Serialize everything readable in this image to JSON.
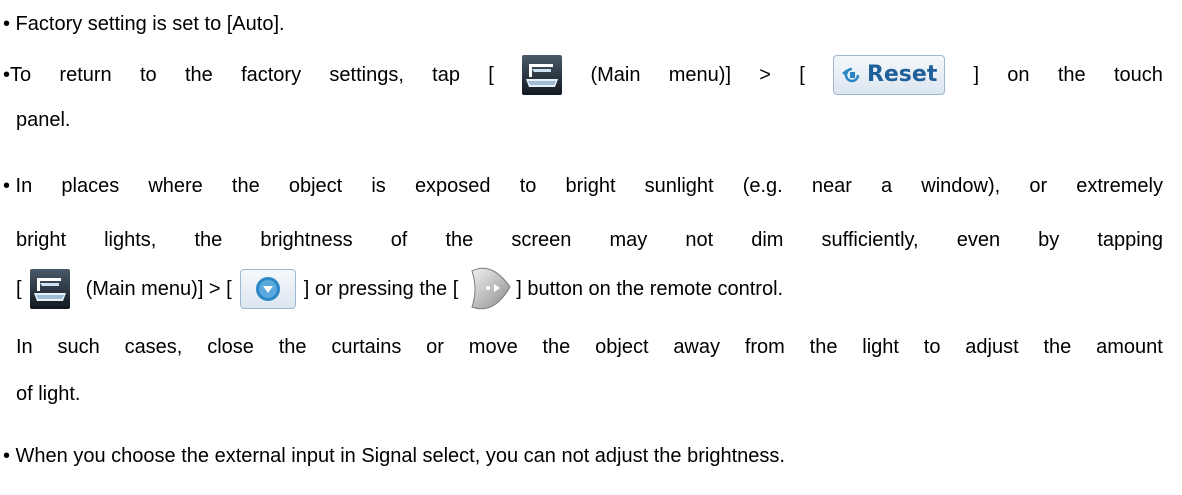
{
  "bullets": {
    "b1": "• Factory setting is set to [Auto].",
    "b2": {
      "w1": "•To",
      "w2": "return",
      "w3": "to",
      "w4": "the",
      "w5": "factory",
      "w6": "settings,",
      "w7": "tap",
      "w8": "[",
      "after_menu": "(Main",
      "w9": "menu)]",
      "w10": ">",
      "w11": "[",
      "reset_label": "Reset",
      "w12": "]",
      "w13": "on",
      "w14": "the",
      "w15": "touch",
      "line2": "panel."
    },
    "b3": {
      "line1": [
        "• In",
        "places",
        "where",
        "the",
        "object",
        "is",
        "exposed",
        "to",
        "bright",
        "sunlight",
        "(e.g.",
        "near",
        "a",
        "window),",
        "or",
        "extremely"
      ],
      "line2": [
        "bright",
        "lights,",
        "the",
        "brightness",
        "of",
        "the",
        "screen",
        "may",
        "not",
        "dim",
        "sufficiently,",
        "even",
        "by",
        "tapping"
      ],
      "l3_open": "[",
      "l3_menu": "(Main menu)] > [",
      "l3_mid": "] or pressing the [",
      "l3_end": "] button on the remote control.",
      "line4": [
        "In",
        "such",
        "cases,",
        "close",
        "the",
        "curtains",
        "or",
        "move",
        "the",
        "object",
        "away",
        "from",
        "the",
        "light",
        "to",
        "adjust",
        "the",
        "amount"
      ],
      "line5": "of light."
    },
    "b4": "• When you choose the external input in Signal select, you can not adjust the brightness."
  },
  "icons": {
    "menu": "main-menu-icon",
    "reset": "reset-icon",
    "down": "down-arrow-icon",
    "remote": "remote-button-icon"
  },
  "colors": {
    "text": "#000000",
    "button_text": "#1f5f9a",
    "button_border": "#9fb8cf",
    "down_circle": "#2b86c5"
  }
}
